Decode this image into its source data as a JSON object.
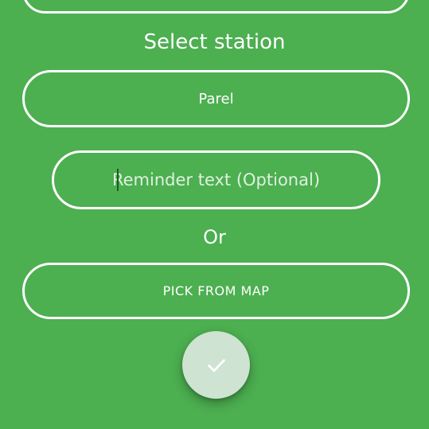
{
  "title": "Select station",
  "station_button": {
    "label": "Parel"
  },
  "reminder_input": {
    "value": "",
    "placeholder": "Reminder text (Optional)"
  },
  "or_label": "Or",
  "pick_map_button": {
    "label": "PICK FROM MAP"
  },
  "confirm_button": {
    "icon": "check-icon"
  },
  "colors": {
    "background": "#4CAF50",
    "outline": "#FFFFFF",
    "fab_background": "#CFE3D2"
  }
}
